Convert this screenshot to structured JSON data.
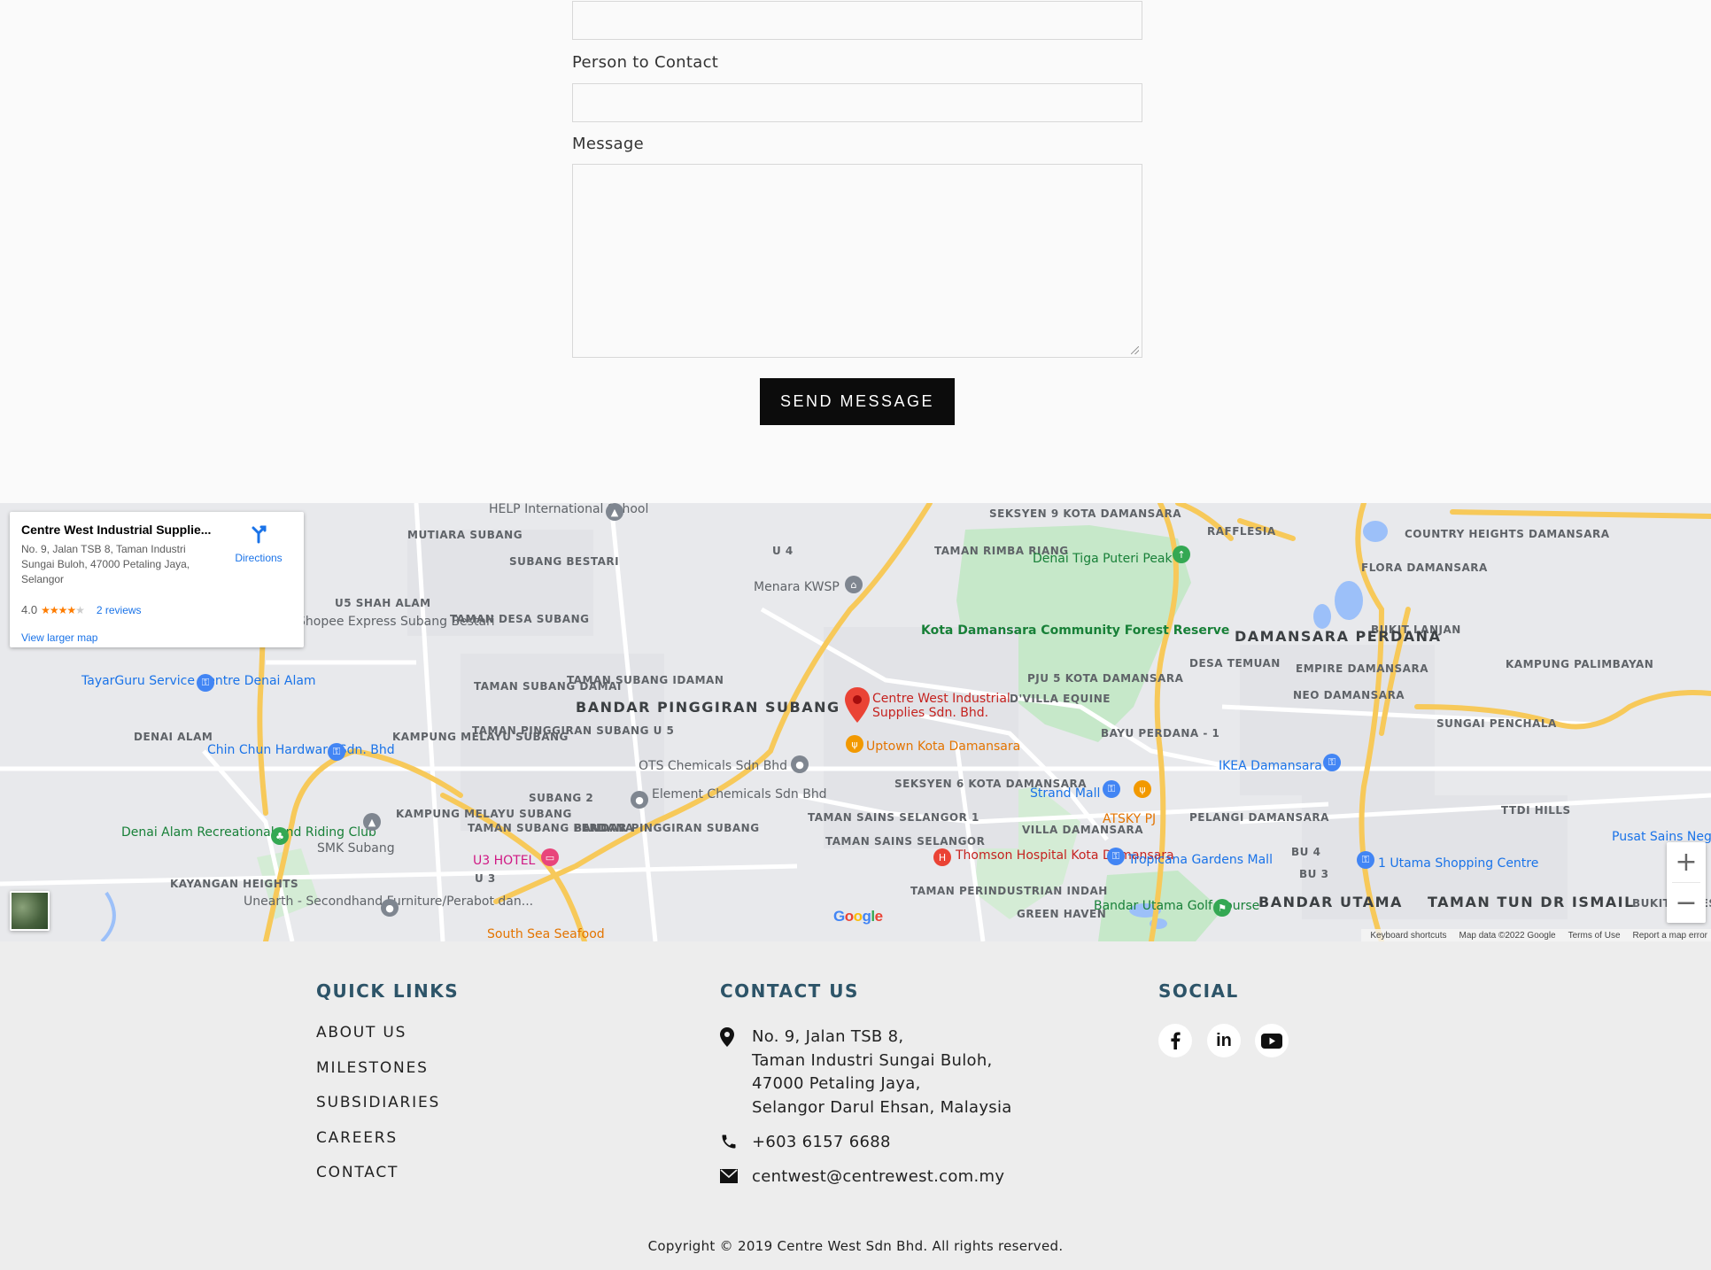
{
  "form": {
    "person_label": "Person to Contact",
    "message_label": "Message",
    "send_label": "SEND MESSAGE"
  },
  "map": {
    "card": {
      "title": "Centre West Industrial Supplie...",
      "address": "No. 9, Jalan TSB 8, Taman Industri Sungai Buloh, 47000 Petaling Jaya, Selangor",
      "rating": "4.0",
      "reviews": "2 reviews",
      "larger_map": "View larger map",
      "directions": "Directions"
    },
    "pin_label": "Centre West Industrial Supplies Sdn. Bhd.",
    "areas": [
      "MUTIARA SUBANG",
      "SUBANG BESTARI",
      "U5 SHAH ALAM",
      "TAMAN DESA SUBANG",
      "U 4",
      "TAMAN SUBANG DAMAI",
      "TAMAN SUBANG IDAMAN",
      "DENAI ALAM",
      "KAMPUNG MELAYU SUBANG",
      "TAMAN PINGGIRAN SUBANG U 5",
      "SUBANG 2",
      "KAMPUNG MELAYU SUBANG",
      "TAMAN SUBANG PERDANA",
      "BANDAR PINGGIRAN SUBANG",
      "U 3",
      "KAYANGAN HEIGHTS",
      "TAMAN RIMBA RIANG",
      "SEKSYEN 9 KOTA DAMANSARA",
      "RAFFLESIA",
      "PJU 5 KOTA DAMANSARA",
      "SEKSYEN 6 KOTA DAMANSARA",
      "TAMAN SAINS SELANGOR 1",
      "TAMAN SAINS SELANGOR",
      "TAMAN PERINDUSTRIAN INDAH",
      "VILLA DAMANSARA",
      "GREEN HAVEN",
      "BAYU PERDANA - 1",
      "PELANGI DAMANSARA",
      "D'VILLA EQUINE",
      "DESA TEMUAN",
      "EMPIRE DAMANSARA",
      "NEO DAMANSARA",
      "FLORA DAMANSARA",
      "COUNTRY HEIGHTS DAMANSARA",
      "BUKIT LANJAN",
      "KAMPUNG PALIMBAYAN",
      "SUNGAI PENCHALA",
      "TTDI HILLS",
      "BU 4",
      "BU 3",
      "BUKIT EQUES"
    ],
    "districts": [
      "BANDAR PINGGIRAN SUBANG",
      "DAMANSARA PERDANA",
      "BANDAR UTAMA",
      "TAMAN TUN DR ISMAIL"
    ],
    "pois": [
      "HELP International School",
      "Menara KWSP",
      "Denai Tiga Puteri Peak",
      "Kota Damansara Community Forest Reserve",
      "Shopee Express Subang Bestari",
      "TayarGuru Service Centre Denai Alam",
      "Chin Chun Hardware Sdn. Bhd",
      "OTS Chemicals Sdn Bhd",
      "Element Chemicals Sdn Bhd",
      "Uptown Kota Damansara",
      "Strand Mall",
      "ATSKY PJ",
      "IKEA Damansara",
      "Denai Alam Recreational and Riding Club",
      "SMK Subang",
      "U3 HOTEL",
      "Thomson Hospital Kota Damansara",
      "Tropicana Gardens Mall",
      "1 Utama Shopping Centre",
      "Bandar Utama Golf Course",
      "Unearth - Secondhand Furniture/Perabot dan...",
      "South Sea Seafood",
      "Pusat Sains Negara"
    ],
    "footer_links": [
      "Keyboard shortcuts",
      "Map data ©2022 Google",
      "Terms of Use",
      "Report a map error"
    ],
    "google": "Google",
    "colors": {
      "road_major": "#f7c95a",
      "road_minor": "#ffffff",
      "water": "#9cc0f9",
      "park": "#c6e8c9",
      "land": "#e8e9ec",
      "pin": "#ea4335"
    }
  },
  "footer": {
    "quick_links": {
      "heading": "QUICK LINKS",
      "items": [
        "ABOUT US",
        "MILESTONES",
        "SUBSIDIARIES",
        "CAREERS",
        "CONTACT"
      ]
    },
    "contact": {
      "heading": "CONTACT US",
      "address_lines": [
        "No. 9, Jalan TSB 8,",
        "Taman Industri Sungai Buloh,",
        "47000 Petaling Jaya,",
        "Selangor Darul Ehsan, Malaysia"
      ],
      "phone": "+603 6157 6688",
      "email": "centwest@centrewest.com.my"
    },
    "social": {
      "heading": "SOCIAL",
      "icons": [
        "facebook-icon",
        "linkedin-icon",
        "youtube-icon"
      ]
    },
    "copyright": "Copyright © 2019 Centre West Sdn Bhd. All rights reserved.",
    "heading_color": "#2d5468"
  }
}
